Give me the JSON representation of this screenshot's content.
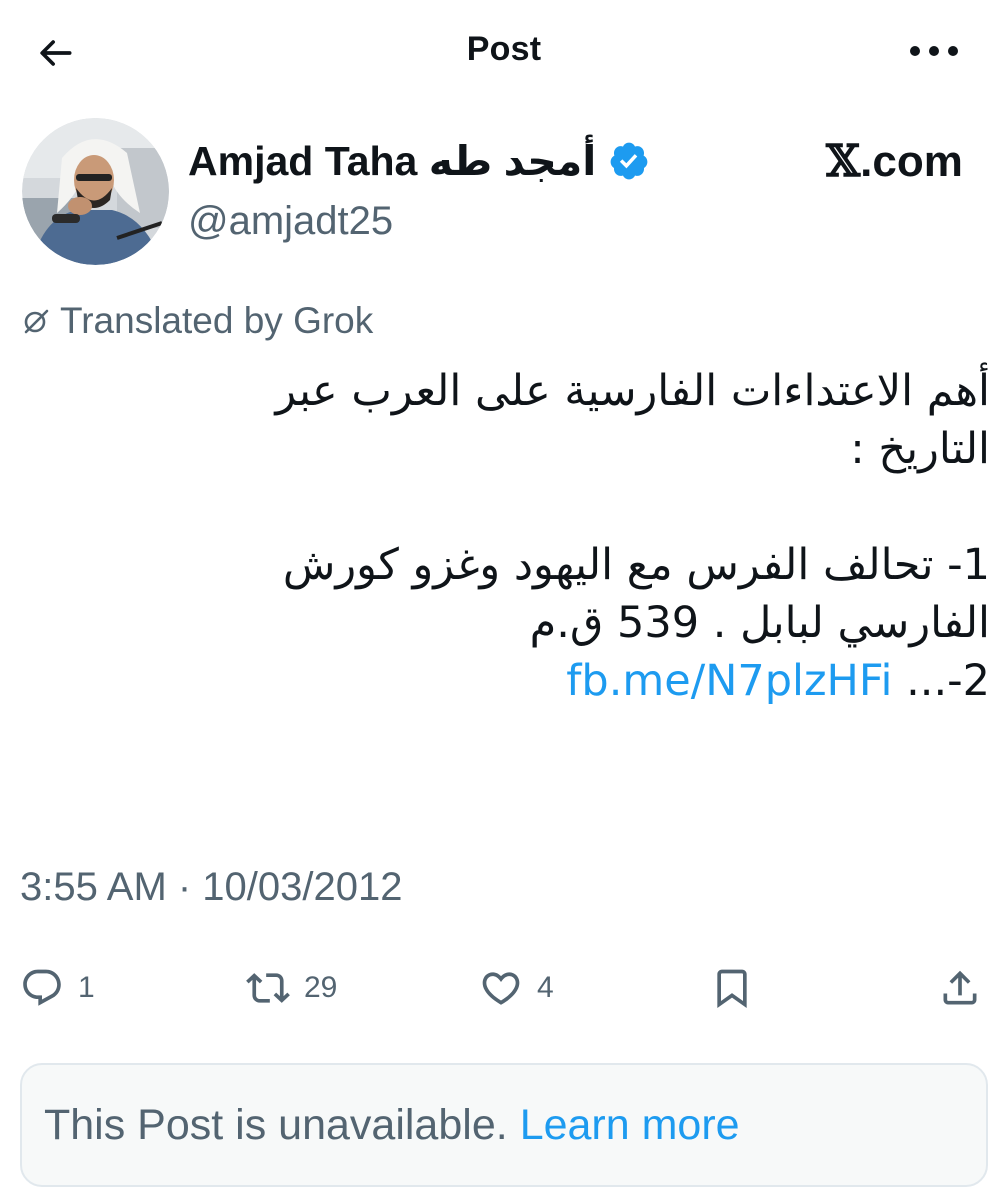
{
  "header": {
    "back_icon": "arrow-left-icon",
    "title": "Post",
    "more_icon": "more-horizontal-icon"
  },
  "author": {
    "avatar_icon": "avatar-photo",
    "name": "Amjad Taha أمجد طه",
    "verified_icon": "verified-badge-icon",
    "handle": "@amjadt25"
  },
  "site_mark": {
    "logo": "𝕏",
    "domain": ".com"
  },
  "translation": {
    "icon": "grok-icon",
    "label": "Translated by Grok"
  },
  "tweet": {
    "lines": [
      "أهم الاعتداءات الفارسية على العرب عبر",
      "التاريخ :",
      "",
      "1- تحالف الفرس مع اليهود وغزو كورش",
      "الفارسي لبابل . 539 ق.م"
    ],
    "last_line_prefix": "2-... ",
    "link": "fb.me/N7plzHFi"
  },
  "timestamp": "3:55 AM · 10/03/2012",
  "actions": {
    "reply": {
      "icon": "reply-icon",
      "count": "1"
    },
    "repost": {
      "icon": "repost-icon",
      "count": "29"
    },
    "like": {
      "icon": "heart-icon",
      "count": "4"
    },
    "bookmark": {
      "icon": "bookmark-icon"
    },
    "share": {
      "icon": "share-icon"
    }
  },
  "quoted": {
    "message": "This Post is unavailable.",
    "learn_more": "Learn more"
  },
  "colors": {
    "text": "#0f1419",
    "secondary": "#536471",
    "accent": "#1d9bf0",
    "verified": "#1d9bf0",
    "card_bg": "#f7f9f9",
    "card_border": "#e1e8ed"
  }
}
